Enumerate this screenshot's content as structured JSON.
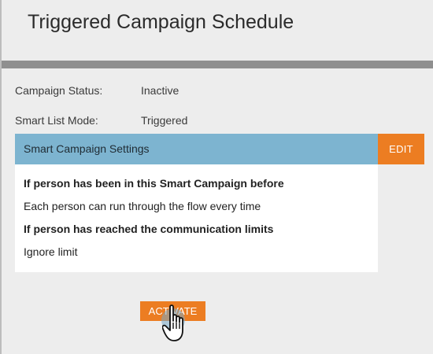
{
  "header": {
    "title": "Triggered Campaign Schedule"
  },
  "fields": [
    {
      "label": "Campaign Status:",
      "value": "Inactive"
    },
    {
      "label": "Smart List Mode:",
      "value": "Triggered"
    }
  ],
  "settings": {
    "title": "Smart Campaign Settings",
    "edit_label": "EDIT",
    "lines": [
      "If person has been in this Smart Campaign before",
      "Each person can run through the flow every time",
      "If person has reached the communication limits",
      "Ignore limit"
    ]
  },
  "actions": {
    "activate_label": "ACTIVATE"
  },
  "colors": {
    "accent_orange": "#ec7d22",
    "settings_bar_blue": "#7db4d0",
    "divider_gray": "#8f8f8f"
  },
  "cursor": {
    "icon": "hand-pointer-icon"
  }
}
